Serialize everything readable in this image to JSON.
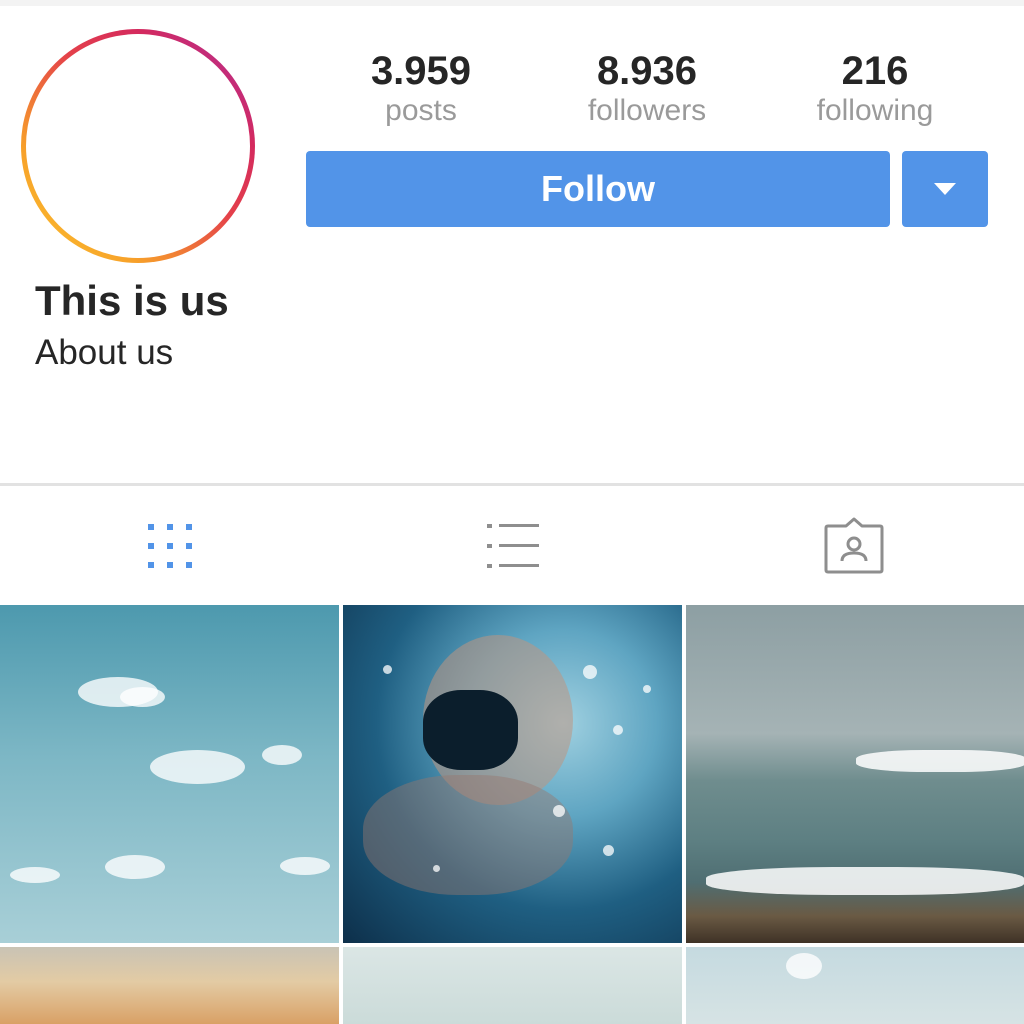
{
  "profile": {
    "name": "This is us",
    "bio": "About us"
  },
  "stats": {
    "posts": {
      "value": "3.959",
      "label": "posts"
    },
    "followers": {
      "value": "8.936",
      "label": "followers"
    },
    "following": {
      "value": "216",
      "label": "following"
    }
  },
  "actions": {
    "follow_label": "Follow",
    "dropdown_icon": "caret-down-icon"
  },
  "tabs": [
    {
      "icon": "grid-icon",
      "active": true
    },
    {
      "icon": "list-icon",
      "active": false
    },
    {
      "icon": "tagged-user-icon",
      "active": false
    }
  ],
  "colors": {
    "accent": "#5294e8",
    "text_primary": "#262626",
    "text_secondary": "#9a9a9a",
    "tab_inactive": "#8e8e8e",
    "story_ring": [
      "#fcc62e",
      "#e4404a",
      "#a92ea3"
    ]
  }
}
